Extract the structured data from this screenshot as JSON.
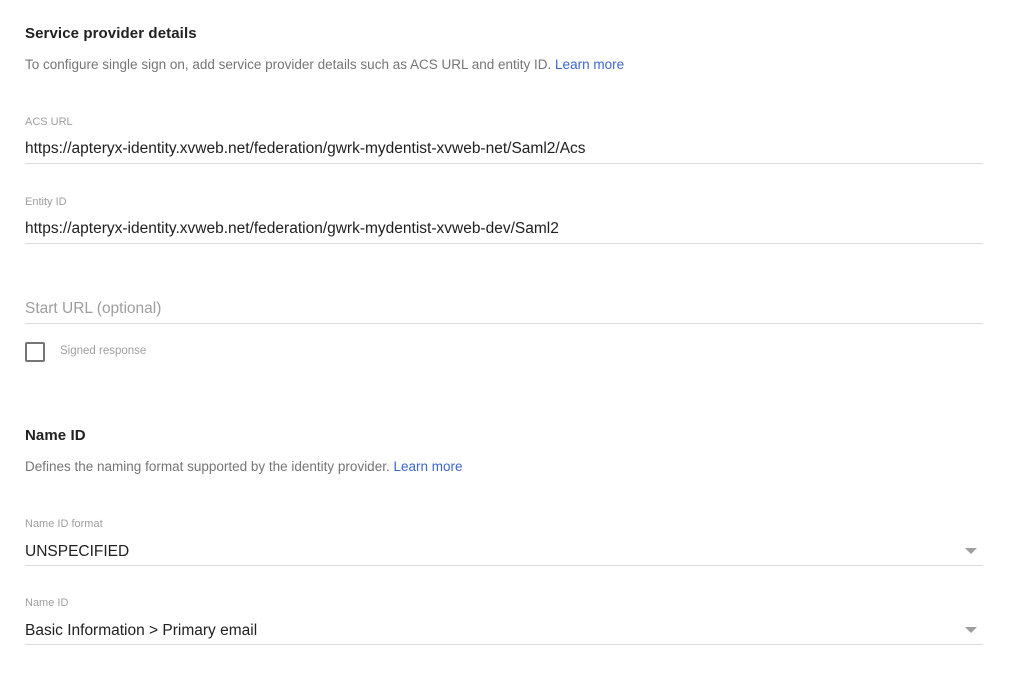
{
  "service_provider": {
    "title": "Service provider details",
    "description": "To configure single sign on, add service provider details such as ACS URL and entity ID.",
    "learn_more": "Learn more",
    "acs_url": {
      "label": "ACS URL",
      "value": "https://apteryx-identity.xvweb.net/federation/gwrk-mydentist-xvweb-net/Saml2/Acs"
    },
    "entity_id": {
      "label": "Entity ID",
      "value": "https://apteryx-identity.xvweb.net/federation/gwrk-mydentist-xvweb-dev/Saml2"
    },
    "start_url": {
      "placeholder": "Start URL (optional)",
      "value": ""
    },
    "signed_response": {
      "label": "Signed response",
      "checked": false
    }
  },
  "name_id": {
    "title": "Name ID",
    "description": "Defines the naming format supported by the identity provider.",
    "learn_more": "Learn more",
    "format": {
      "label": "Name ID format",
      "selected": "UNSPECIFIED",
      "icon": "chevron-down-icon"
    },
    "mapping": {
      "label": "Name ID",
      "selected": "Basic Information > Primary email",
      "icon": "chevron-down-icon"
    }
  },
  "colors": {
    "link": "#3b67c8",
    "text": "#212121",
    "muted": "#757575",
    "hint": "#9e9e9e",
    "divider": "#dcdcdc"
  }
}
